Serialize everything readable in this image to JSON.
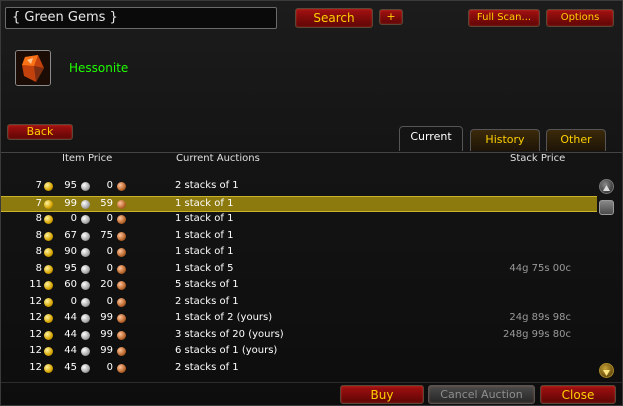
{
  "search": {
    "value": "{ Green Gems }"
  },
  "top_buttons": {
    "search": "Search",
    "plus": "+",
    "full_scan": "Full Scan...",
    "options": "Options"
  },
  "item": {
    "name": "Hessonite",
    "name_color": "#1eff00",
    "icon": "orange-gem-icon"
  },
  "back_button": "Back",
  "tabs": [
    {
      "label": "Current",
      "active": true
    },
    {
      "label": "History",
      "active": false
    },
    {
      "label": "Other",
      "active": false
    }
  ],
  "columns": {
    "item_price": "Item Price",
    "current_auctions": "Current Auctions",
    "stack_price": "Stack Price"
  },
  "rows": [
    {
      "gold": "7",
      "silver": "95",
      "copper": "0",
      "desc": "2 stacks of 1",
      "stack": ""
    },
    {
      "gold": "7",
      "silver": "99",
      "copper": "59",
      "desc": "1 stack of 1",
      "stack": "",
      "selected": true
    },
    {
      "gold": "8",
      "silver": "0",
      "copper": "0",
      "desc": "1 stack of 1",
      "stack": ""
    },
    {
      "gold": "8",
      "silver": "67",
      "copper": "75",
      "desc": "1 stack of 1",
      "stack": ""
    },
    {
      "gold": "8",
      "silver": "90",
      "copper": "0",
      "desc": "1 stack of 1",
      "stack": ""
    },
    {
      "gold": "8",
      "silver": "95",
      "copper": "0",
      "desc": "1 stack of 5",
      "stack": "44g 75s 00c"
    },
    {
      "gold": "11",
      "silver": "60",
      "copper": "20",
      "desc": "5 stacks of 1",
      "stack": ""
    },
    {
      "gold": "12",
      "silver": "0",
      "copper": "0",
      "desc": "2 stacks of 1",
      "stack": ""
    },
    {
      "gold": "12",
      "silver": "44",
      "copper": "99",
      "desc": "1 stack of 2 (yours)",
      "stack": "24g 89s 98c"
    },
    {
      "gold": "12",
      "silver": "44",
      "copper": "99",
      "desc": "3 stacks of 20 (yours)",
      "stack": "248g 99s 80c"
    },
    {
      "gold": "12",
      "silver": "44",
      "copper": "99",
      "desc": "6 stacks of 1 (yours)",
      "stack": ""
    },
    {
      "gold": "12",
      "silver": "45",
      "copper": "0",
      "desc": "2 stacks of 1",
      "stack": ""
    }
  ],
  "bottom_buttons": {
    "buy": "Buy",
    "cancel_auction": "Cancel Auction",
    "close": "Close"
  },
  "colors": {
    "button_red": "#8c0d0d",
    "button_text": "#ffd100",
    "selected_row": "#8c7a0e"
  }
}
